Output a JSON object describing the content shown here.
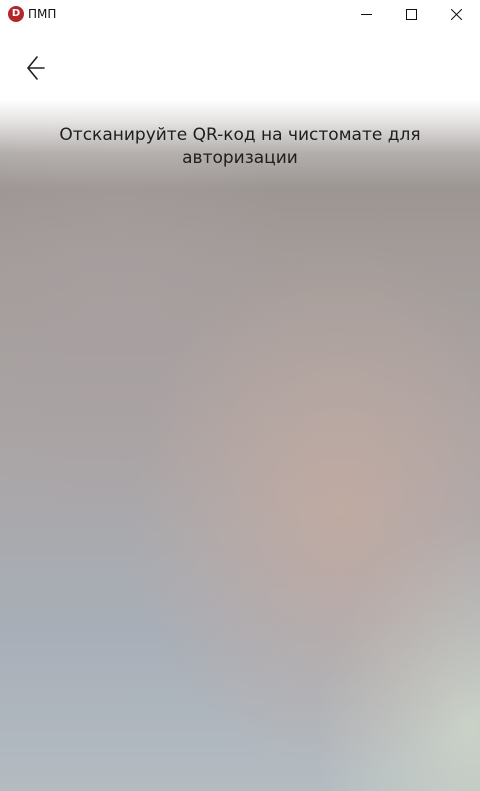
{
  "window": {
    "title": "ПМП",
    "logo_letter": "D",
    "logo_color": "#b3262d",
    "controls": [
      "minimize-icon",
      "maximize-icon",
      "close-icon"
    ]
  },
  "scanner": {
    "back_icon": "arrow-left-icon",
    "instruction": "Отсканируйте QR-код на чистомате для авторизации"
  }
}
